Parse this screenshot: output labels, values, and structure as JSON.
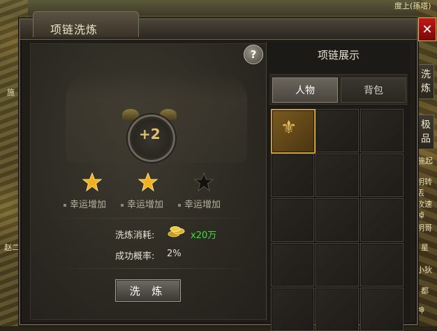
{
  "window": {
    "title": "项链洗炼",
    "close_label": "✕"
  },
  "help_label": "?",
  "emblem": {
    "level_text": "+2"
  },
  "stars": [
    {
      "filled": true,
      "label": "幸运增加"
    },
    {
      "filled": true,
      "label": "幸运增加"
    },
    {
      "filled": false,
      "label": "幸运增加"
    }
  ],
  "cost": {
    "label": "洗炼消耗:",
    "value": "x20万"
  },
  "rate": {
    "label": "成功概率:",
    "value": "2%"
  },
  "refine_button": "洗 炼",
  "showcase": {
    "title": "项链展示",
    "tabs": [
      {
        "label": "人物",
        "active": true
      },
      {
        "label": "背包",
        "active": false
      }
    ],
    "rows": 5,
    "cols": 3,
    "filled_slot_index": 0
  },
  "side_tabs": {
    "refine": "洗\n炼",
    "extreme": "极\n品"
  },
  "world_text": {
    "top_right": "度上(孫塔)",
    "left_1": "施",
    "left_2": "赵二",
    "right_1": "施起",
    "right_2": "明转丢",
    "right_3": "攻速掉",
    "right_4": "明哥",
    "right_5": "星",
    "right_6": "小狄",
    "right_7": "都",
    "right_8": "神"
  },
  "colors": {
    "accent_gold": "#c89a30",
    "cost_green": "#3adf3a",
    "close_red": "#c01818"
  }
}
